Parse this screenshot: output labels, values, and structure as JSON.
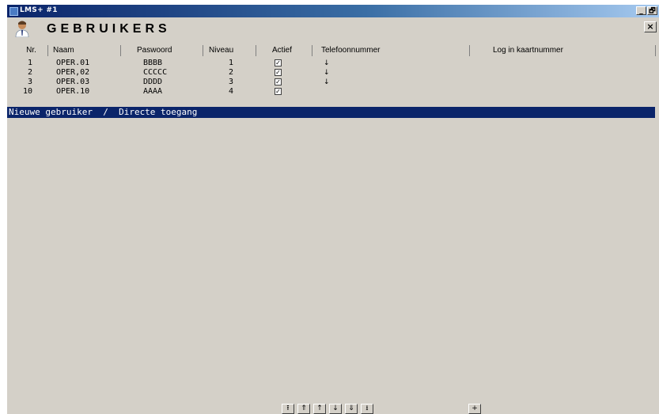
{
  "window": {
    "title": "LMS+  #1",
    "minimize": "_",
    "restore": "🗗",
    "close": "×"
  },
  "page": {
    "title": "GEBRUIKERS",
    "icon": "user-icon"
  },
  "columns": [
    "Nr.",
    "Naam",
    "Paswoord",
    "Niveau",
    "Actief",
    "Telefoonnummer",
    "Log in kaartnummer"
  ],
  "rows": [
    {
      "nr": "1",
      "naam": "OPER.01",
      "pas": "BBBB",
      "niv": "1",
      "actief": "✓",
      "tel": "↓"
    },
    {
      "nr": "2",
      "naam": "OPER,02",
      "pas": "CCCCC",
      "niv": "2",
      "actief": "✓",
      "tel": "↓"
    },
    {
      "nr": "3",
      "naam": "OPER.03",
      "pas": "DDDD",
      "niv": "3",
      "actief": "✓",
      "tel": "↓"
    },
    {
      "nr": "10",
      "naam": "OPER.10",
      "pas": "AAAA",
      "niv": "4",
      "actief": "✓",
      "tel": ""
    }
  ],
  "new_user_bar": "Nieuwe gebruiker  /  Directe toegang",
  "nav_buttons": {
    "first": "⭱",
    "page_up": "⇑",
    "up": "↑",
    "down": "↓",
    "page_down": "⇓",
    "last": "⭳",
    "add": "+"
  },
  "colors": {
    "selection": "#0a246a",
    "face": "#d4d0c8"
  }
}
